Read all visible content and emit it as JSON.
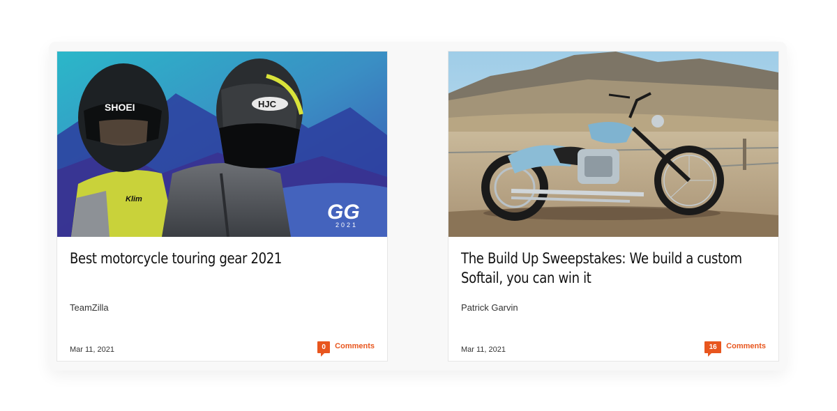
{
  "articles": [
    {
      "title": "Best motorcycle touring gear 2021",
      "title_lines": [
        "Best motorcycle touring gear 2021"
      ],
      "author": "TeamZilla",
      "date": "Mar 11, 2021",
      "comment_count": "0",
      "comments_label": "Comments",
      "image": {
        "helmet_brand_left": "SHOEI",
        "helmet_brand_right": "HJC",
        "jacket_brand": "Klim",
        "badge_logo": "GG",
        "badge_year": "2021"
      }
    },
    {
      "title": "The Build Up Sweepstakes: We build a custom Softail, you can win it",
      "title_lines": [
        "The Build Up Sweepstakes: We build a custom",
        "Softail, you can win it"
      ],
      "author": "Patrick Garvin",
      "date": "Mar 11, 2021",
      "comment_count": "16",
      "comments_label": "Comments"
    }
  ],
  "colors": {
    "accent": "#e8561e",
    "title_text": "#111111",
    "meta_text": "#333333"
  },
  "icons": {
    "comments": "comment-bubble-icon"
  }
}
